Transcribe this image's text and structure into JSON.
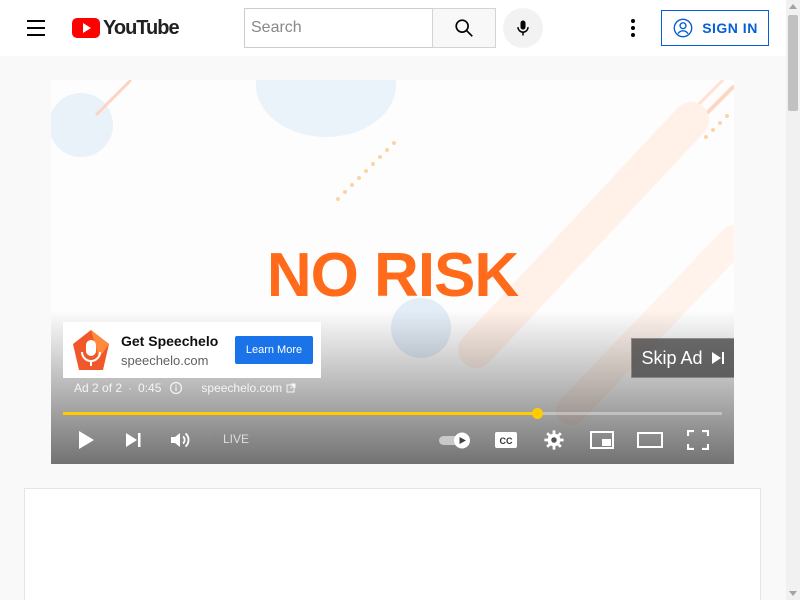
{
  "masthead": {
    "logo_text": "YouTube",
    "search_placeholder": "Search",
    "signin_label": "SIGN IN"
  },
  "player": {
    "headline": "NO RISK",
    "ad": {
      "title": "Get Speechelo",
      "domain": "speechelo.com",
      "cta_label": "Learn More",
      "skip_label": "Skip Ad",
      "ad_counter": "Ad 2 of 2",
      "time_remaining": "0:45",
      "ad_url": "speechelo.com"
    },
    "progress_fraction": 0.72,
    "live_label": "LIVE",
    "accent_color": "#ffcc00",
    "headline_color": "#ff6b1a"
  },
  "icons": [
    "menu-icon",
    "youtube-logo-icon",
    "search-icon",
    "mic-icon",
    "more-vert-icon",
    "account-icon",
    "play-icon",
    "next-icon",
    "volume-icon",
    "autoplay-toggle-icon",
    "captions-icon",
    "settings-icon",
    "miniplayer-icon",
    "theater-icon",
    "fullscreen-icon",
    "skip-next-icon",
    "info-icon",
    "external-link-icon"
  ]
}
